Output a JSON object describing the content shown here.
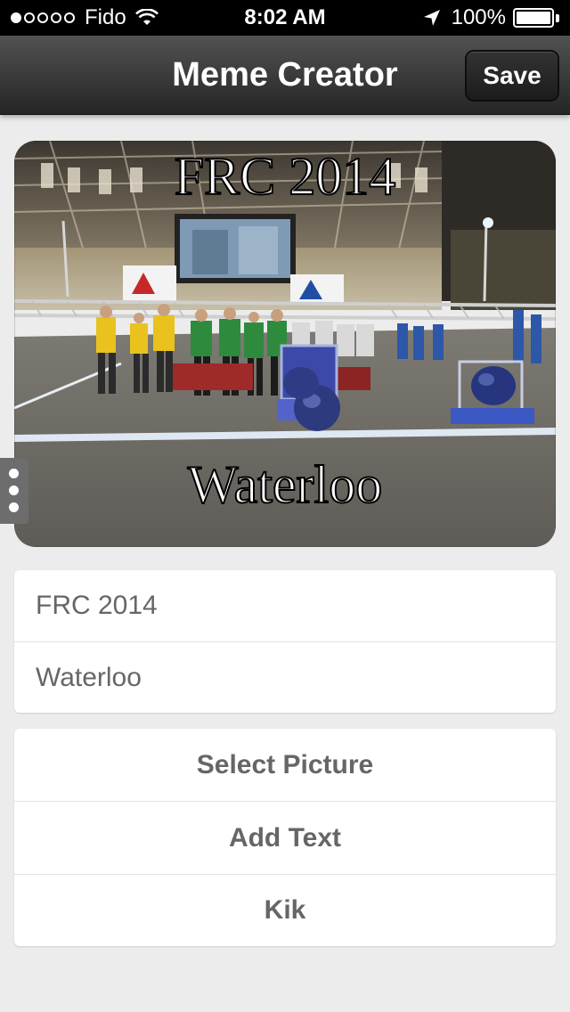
{
  "status_bar": {
    "carrier": "Fido",
    "time": "8:02 AM",
    "battery": "100%",
    "battery_level": 1.0,
    "signal_dots": 5,
    "signal_filled": 1,
    "icons": [
      "wifi-icon",
      "location-arrow-icon",
      "battery-icon"
    ]
  },
  "nav": {
    "title": "Meme Creator",
    "save_label": "Save"
  },
  "meme": {
    "top_text": "FRC 2014",
    "bottom_text": "Waterloo"
  },
  "fields": {
    "top_text_value": "FRC 2014",
    "bottom_text_value": "Waterloo"
  },
  "actions": {
    "select_picture": "Select Picture",
    "add_text": "Add Text",
    "kik": "Kik"
  },
  "colors": {
    "background": "#ececec",
    "nav_bar": "#3a3a3a",
    "text_gray": "#666666"
  }
}
